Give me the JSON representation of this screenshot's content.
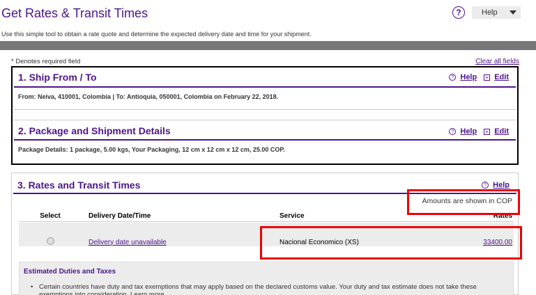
{
  "header": {
    "title": "Get Rates & Transit Times",
    "help_icon": "?",
    "help_label": "Help",
    "subtitle": "Use this simple tool to obtain a rate quote and determine the expected delivery date and time for your shipment."
  },
  "form": {
    "required_note": "* Denotes required field",
    "clear_all": "Clear all fields"
  },
  "section1": {
    "title": "1. Ship From / To",
    "help": "Help",
    "edit": "Edit",
    "summary": "From: Neiva, 410001, Colombia | To: Antioquia, 050001, Colombia on February 22, 2018."
  },
  "section2": {
    "title": "2. Package and Shipment Details",
    "help": "Help",
    "edit": "Edit",
    "summary": "Package Details: 1 package, 5.00 kgs, Your Packaging, 12 cm x 12 cm x 12 cm, 25.00 COP."
  },
  "section3": {
    "title": "3. Rates and Transit Times",
    "help": "Help",
    "amounts_note": "Amounts are shown in COP",
    "columns": [
      "Select",
      "Delivery Date/Time",
      "Service",
      "Rates"
    ],
    "rows": [
      {
        "delivery": "Delivery date unavailable",
        "service": "Nacional Economico (XS)",
        "rate": "33400.00"
      }
    ],
    "duties": {
      "title": "Estimated Duties and Taxes",
      "text": "Certain countries have duty and tax exemptions that may apply based on the declared customs value. Your duty and tax estimate does not take these exemptions into consideration. Learn more"
    }
  },
  "colors": {
    "brand_purple": "#4d148c",
    "highlight_red": "#e00000"
  }
}
